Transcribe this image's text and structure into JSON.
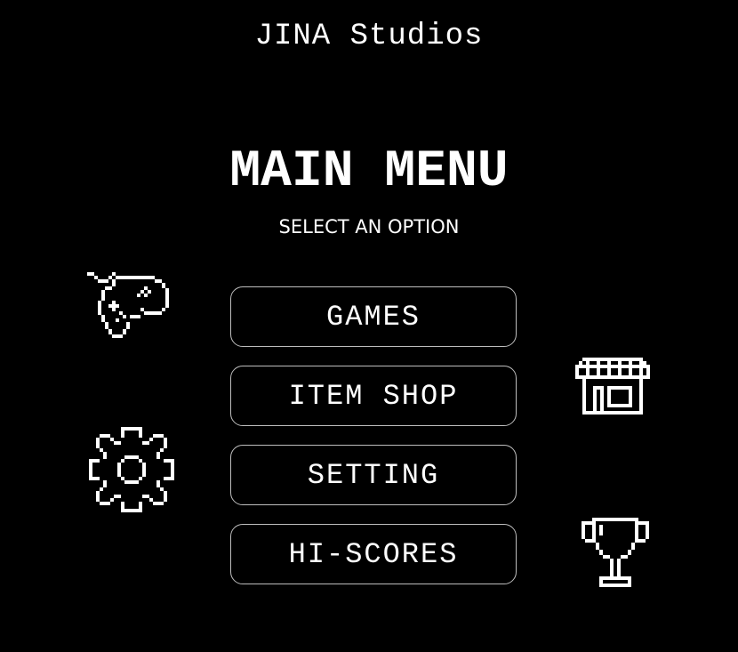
{
  "studio": "JINA Studios",
  "menu": {
    "title": "MAIN MENU",
    "subtitle": "SELECT AN OPTION",
    "buttons": {
      "games": "GAMES",
      "item_shop": "ITEM SHOP",
      "setting": "SETTING",
      "hi_scores": "HI-SCORES"
    }
  },
  "icons": {
    "games": "gamepad-icon",
    "item_shop": "shop-icon",
    "setting": "gear-icon",
    "hi_scores": "trophy-icon"
  },
  "colors": {
    "background": "#000000",
    "text": "#ffffff",
    "button_border": "#bdbdbd"
  }
}
